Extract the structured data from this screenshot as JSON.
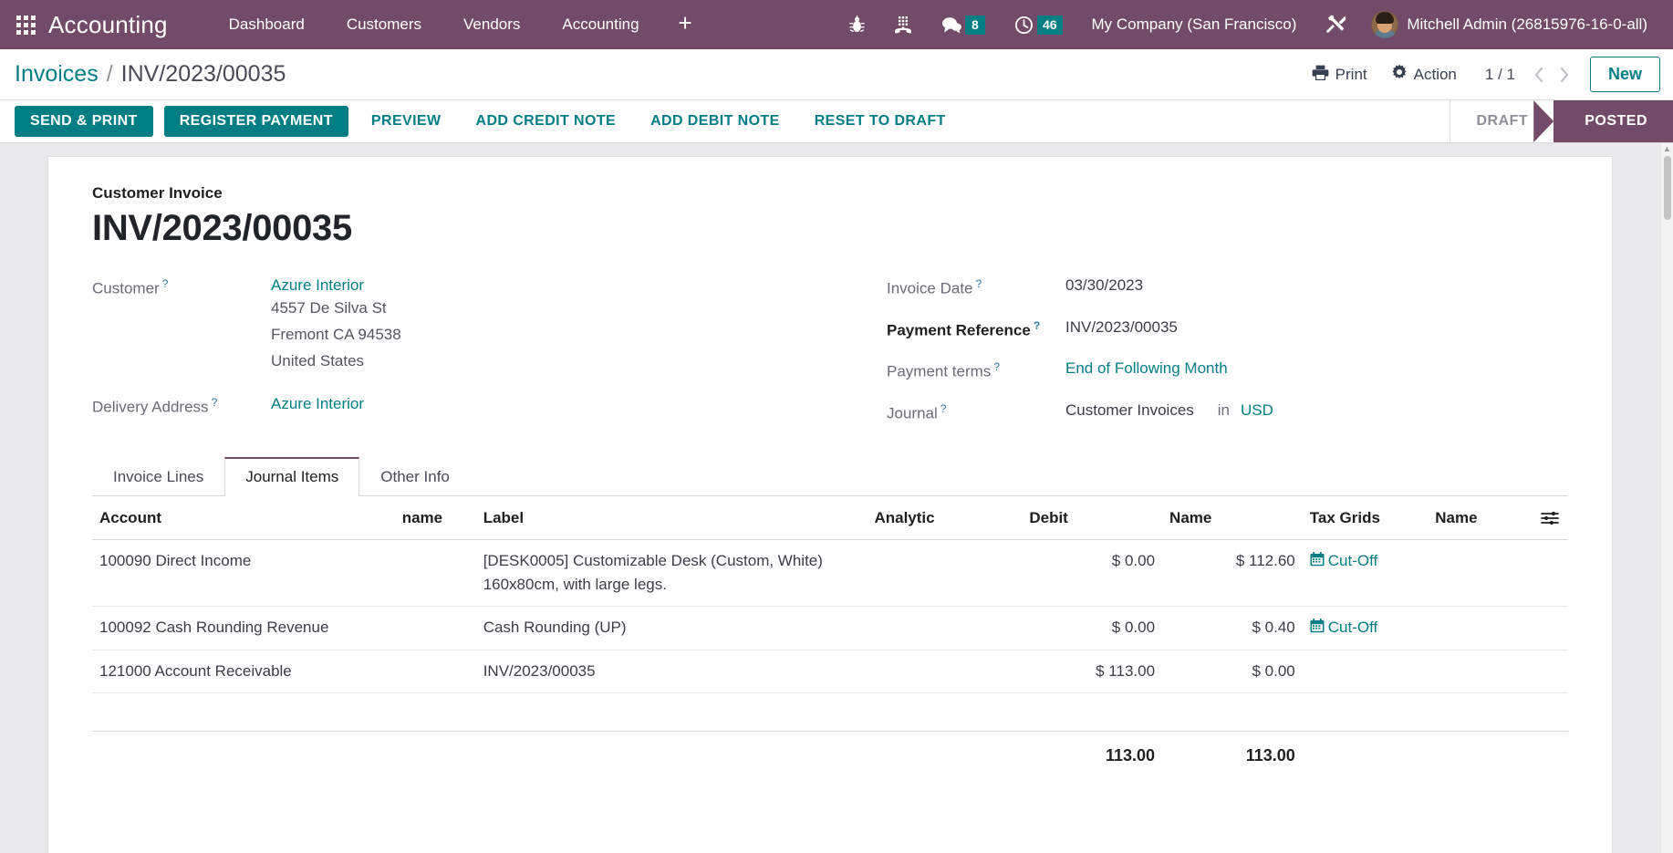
{
  "navbar": {
    "apps_icon": "apps-grid-icon",
    "brand": "Accounting",
    "menu": [
      {
        "label": "Dashboard"
      },
      {
        "label": "Customers"
      },
      {
        "label": "Vendors"
      },
      {
        "label": "Accounting"
      }
    ],
    "plus": "+",
    "sys_icons": [
      {
        "name": "bug-icon"
      },
      {
        "name": "dialpad-icon"
      },
      {
        "name": "messages-icon",
        "badge": "8"
      },
      {
        "name": "activities-clock-icon",
        "badge": "46"
      }
    ],
    "company": "My Company (San Francisco)",
    "tools_icon": "tools-icon",
    "user": "Mitchell Admin (26815976-16-0-all)"
  },
  "control_panel": {
    "breadcrumb_root": "Invoices",
    "breadcrumb_separator": "/",
    "breadcrumb_current": "INV/2023/00035",
    "print_label": "Print",
    "action_label": "Action",
    "pager": "1 / 1",
    "new_label": "New"
  },
  "statusbar": {
    "buttons": [
      {
        "label": "SEND & PRINT",
        "style": "primary"
      },
      {
        "label": "REGISTER PAYMENT",
        "style": "primary"
      },
      {
        "label": "PREVIEW",
        "style": "link"
      },
      {
        "label": "ADD CREDIT NOTE",
        "style": "link"
      },
      {
        "label": "ADD DEBIT NOTE",
        "style": "link"
      },
      {
        "label": "RESET TO DRAFT",
        "style": "link"
      }
    ],
    "states": [
      {
        "label": "DRAFT",
        "active": false
      },
      {
        "label": "POSTED",
        "active": true
      }
    ]
  },
  "form": {
    "subtitle": "Customer Invoice",
    "title": "INV/2023/00035",
    "left": {
      "customer_label": "Customer",
      "customer_value": "Azure Interior",
      "address": [
        "4557 De Silva St",
        "Fremont CA 94538",
        "United States"
      ],
      "delivery_label": "Delivery Address",
      "delivery_value": "Azure Interior"
    },
    "right": {
      "invoice_date_label": "Invoice Date",
      "invoice_date_value": "03/30/2023",
      "payment_ref_label": "Payment Reference",
      "payment_ref_value": "INV/2023/00035",
      "payment_terms_label": "Payment terms",
      "payment_terms_value": "End of Following Month",
      "journal_label": "Journal",
      "journal_value": "Customer Invoices",
      "in_label": "in",
      "currency": "USD"
    },
    "help_marker": "?"
  },
  "tabs": [
    {
      "label": "Invoice Lines",
      "active": false
    },
    {
      "label": "Journal Items",
      "active": true
    },
    {
      "label": "Other Info",
      "active": false
    }
  ],
  "table": {
    "headers": [
      "Account",
      "name",
      "Label",
      "Analytic",
      "Debit",
      "Name",
      "Tax Grids",
      "Name"
    ],
    "optional_columns_icon": "sliders-icon",
    "rows": [
      {
        "account": "100090 Direct Income",
        "name": "",
        "label": "[DESK0005] Customizable Desk (Custom, White)",
        "label_line2": "160x80cm, with large legs.",
        "analytic": "",
        "debit": "$ 0.00",
        "credit": "$ 112.60",
        "tax_grids": "Cut-Off",
        "tax_grids_icon": "calendar-icon",
        "name2": ""
      },
      {
        "account": "100092 Cash Rounding Revenue",
        "name": "",
        "label": "Cash Rounding (UP)",
        "label_line2": "",
        "analytic": "",
        "debit": "$ 0.00",
        "credit": "$ 0.40",
        "tax_grids": "Cut-Off",
        "tax_grids_icon": "calendar-icon",
        "name2": ""
      },
      {
        "account": "121000 Account Receivable",
        "name": "",
        "label": "INV/2023/00035",
        "label_line2": "",
        "analytic": "",
        "debit": "$ 113.00",
        "credit": "$ 0.00",
        "tax_grids": "",
        "tax_grids_icon": "",
        "name2": ""
      }
    ],
    "totals": {
      "debit": "113.00",
      "credit": "113.00"
    }
  },
  "colors": {
    "brand_purple": "#714B67",
    "accent_teal": "#017e84",
    "badge_teal": "#017e84"
  }
}
